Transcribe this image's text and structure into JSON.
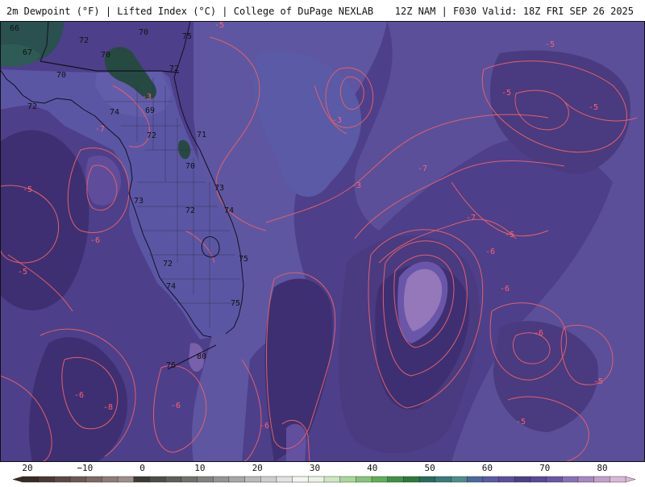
{
  "header": {
    "title_left": "2m Dewpoint (°F) | Lifted Index (°C) | College of DuPage NEXLAB",
    "title_right": "12Z NAM | F030 Valid: 18Z FRI SEP 26 2025"
  },
  "map": {
    "dewpoint_labels": [
      {
        "id": "dp-1",
        "text": "66"
      },
      {
        "id": "dp-2",
        "text": "70"
      },
      {
        "id": "dp-3",
        "text": "67"
      },
      {
        "id": "dp-4",
        "text": "72"
      },
      {
        "id": "dp-5",
        "text": "70"
      },
      {
        "id": "dp-6",
        "text": "75"
      },
      {
        "id": "dp-7",
        "text": "70"
      },
      {
        "id": "dp-8",
        "text": "72"
      },
      {
        "id": "dp-9",
        "text": "70"
      },
      {
        "id": "dp-10",
        "text": "72"
      },
      {
        "id": "dp-11",
        "text": "74"
      },
      {
        "id": "dp-12",
        "text": "69"
      },
      {
        "id": "dp-13",
        "text": "72"
      },
      {
        "id": "dp-14",
        "text": "71"
      },
      {
        "id": "dp-15",
        "text": "70"
      },
      {
        "id": "dp-16",
        "text": "73"
      },
      {
        "id": "dp-17",
        "text": "73"
      },
      {
        "id": "dp-18",
        "text": "72"
      },
      {
        "id": "dp-19",
        "text": "74"
      },
      {
        "id": "dp-20",
        "text": "75"
      },
      {
        "id": "dp-21",
        "text": "72"
      },
      {
        "id": "dp-22",
        "text": "74"
      },
      {
        "id": "dp-23",
        "text": "75"
      },
      {
        "id": "dp-24",
        "text": "76"
      },
      {
        "id": "dp-25",
        "text": "80"
      }
    ],
    "li_labels": [
      {
        "id": "li-1",
        "text": "-5"
      },
      {
        "id": "li-2",
        "text": "-3"
      },
      {
        "id": "li-3",
        "text": "-7"
      },
      {
        "id": "li-4",
        "text": "-5"
      },
      {
        "id": "li-5",
        "text": "-6"
      },
      {
        "id": "li-6",
        "text": "-5"
      },
      {
        "id": "li-7",
        "text": "-3"
      },
      {
        "id": "li-8",
        "text": "-3"
      },
      {
        "id": "li-9",
        "text": "-5"
      },
      {
        "id": "li-10",
        "text": "-5"
      },
      {
        "id": "li-11",
        "text": "-5"
      },
      {
        "id": "li-12",
        "text": "-7"
      },
      {
        "id": "li-13",
        "text": "-7"
      },
      {
        "id": "li-14",
        "text": "-6"
      },
      {
        "id": "li-15",
        "text": "-5"
      },
      {
        "id": "li-16",
        "text": "-6"
      },
      {
        "id": "li-17",
        "text": "-6"
      },
      {
        "id": "li-18",
        "text": "-5"
      },
      {
        "id": "li-19",
        "text": "-6"
      },
      {
        "id": "li-20",
        "text": "-8"
      },
      {
        "id": "li-21",
        "text": "-6"
      },
      {
        "id": "li-22",
        "text": "-6"
      },
      {
        "id": "li-23",
        "text": "-5"
      }
    ]
  },
  "scale": {
    "ticks": [
      "20",
      "−10",
      "0",
      "10",
      "20",
      "30",
      "40",
      "50",
      "60",
      "70",
      "80"
    ],
    "colors": [
      "#3a2a24",
      "#4a3a33",
      "#5a4a42",
      "#6b5a50",
      "#7c6b60",
      "#8d7d73",
      "#9e8f86",
      "#3c3a35",
      "#4e4c46",
      "#605e58",
      "#72706a",
      "#848280",
      "#969492",
      "#a8a6a4",
      "#bcbab8",
      "#d0cecc",
      "#e4e2e0",
      "#f4f3f0",
      "#e8f3e2",
      "#cde8c0",
      "#a8d898",
      "#86c578",
      "#5fae58",
      "#3f9244",
      "#2c7a3a",
      "#2a6a5a",
      "#3a7a7a",
      "#4e8c8c",
      "#4a6a9a",
      "#5a5aa6",
      "#5b4f9a",
      "#4e3f8a",
      "#5a4898",
      "#6a56a8",
      "#8a70b8",
      "#a688c2",
      "#c3a0cc",
      "#d8b8d6"
    ]
  }
}
